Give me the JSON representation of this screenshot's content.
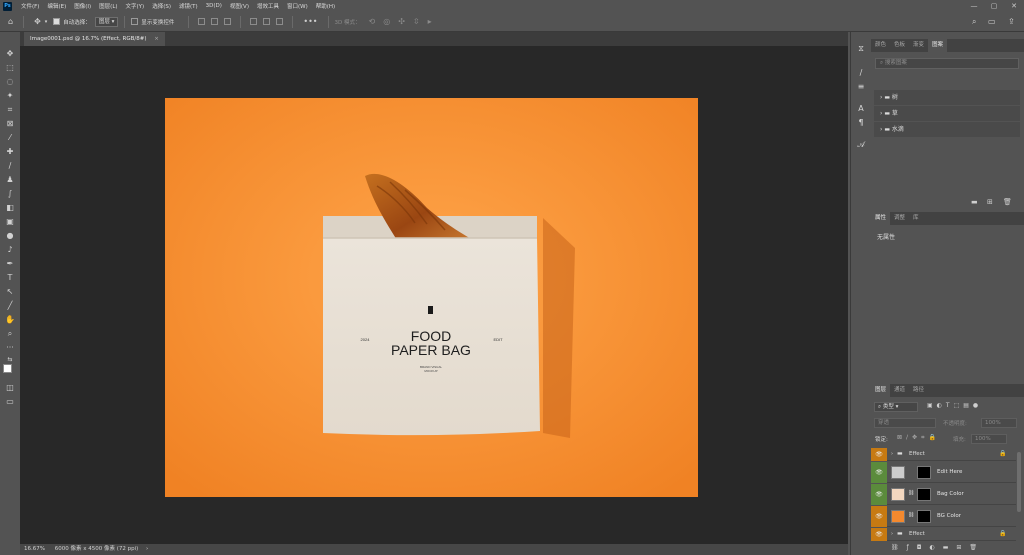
{
  "menubar": {
    "logo": "Ps",
    "items": [
      "文件(F)",
      "编辑(E)",
      "图像(I)",
      "图层(L)",
      "文字(Y)",
      "选择(S)",
      "滤镜(T)",
      "3D(D)",
      "视图(V)",
      "增效工具",
      "窗口(W)",
      "帮助(H)"
    ],
    "minimize": "—",
    "maximize": "▢",
    "close": "✕"
  },
  "options": {
    "auto_select_label": "自动选择：",
    "auto_select_value": "图层",
    "show_transform_label": "显示变换控件",
    "mode_3d_label": "3D 模式："
  },
  "document_tab": {
    "title": "Image0001.psd @ 16.7% (Effect, RGB/8#)",
    "close": "×"
  },
  "canvas": {
    "bg_color": "#f4892e",
    "bag_text_line1": "FOOD",
    "bag_text_line2": "PAPER BAG",
    "bag_year": "2024",
    "bag_edit": "EDIT",
    "bag_small_line1": "BRAND VISUAL",
    "bag_small_line2": "MOCKUP"
  },
  "statusbar": {
    "zoom": "16.67%",
    "doc_info": "6000 像素 x 4500 像素 (72 ppi)",
    "arrow": "›"
  },
  "color_panel": {
    "tabs": [
      "颜色",
      "色板",
      "渐变",
      "图案"
    ],
    "active_tab": 3,
    "search_placeholder": "搜索图案",
    "groups": [
      "树",
      "草",
      "水滴"
    ]
  },
  "properties_panel": {
    "tabs": [
      "属性",
      "调整",
      "库"
    ],
    "active_tab": 0,
    "empty_text": "无属性"
  },
  "layers_panel": {
    "tabs": [
      "图层",
      "通道",
      "路径"
    ],
    "active_tab": 0,
    "filter_kind": "类型",
    "blend_mode": "穿透",
    "opacity_label": "不透明度:",
    "opacity_value": "100%",
    "lock_label": "锁定:",
    "fill_label": "填充:",
    "fill_value": "100%",
    "layers": [
      {
        "name": "Effect",
        "type": "group",
        "eye_color": "#c77a12"
      },
      {
        "name": "Edit Here",
        "type": "smart",
        "eye_color": "#5b8b3c"
      },
      {
        "name": "Bag Color",
        "type": "fill",
        "eye_color": "#5b8b3c"
      },
      {
        "name": "BG Color",
        "type": "fill",
        "eye_color": "#c77a12"
      },
      {
        "name": "Effect",
        "type": "group",
        "eye_color": "#c77a12"
      }
    ],
    "footer_icons": [
      "link-icon",
      "fx-icon",
      "mask-icon",
      "adjustment-icon",
      "folder-icon",
      "new-layer-icon",
      "trash-icon"
    ]
  }
}
